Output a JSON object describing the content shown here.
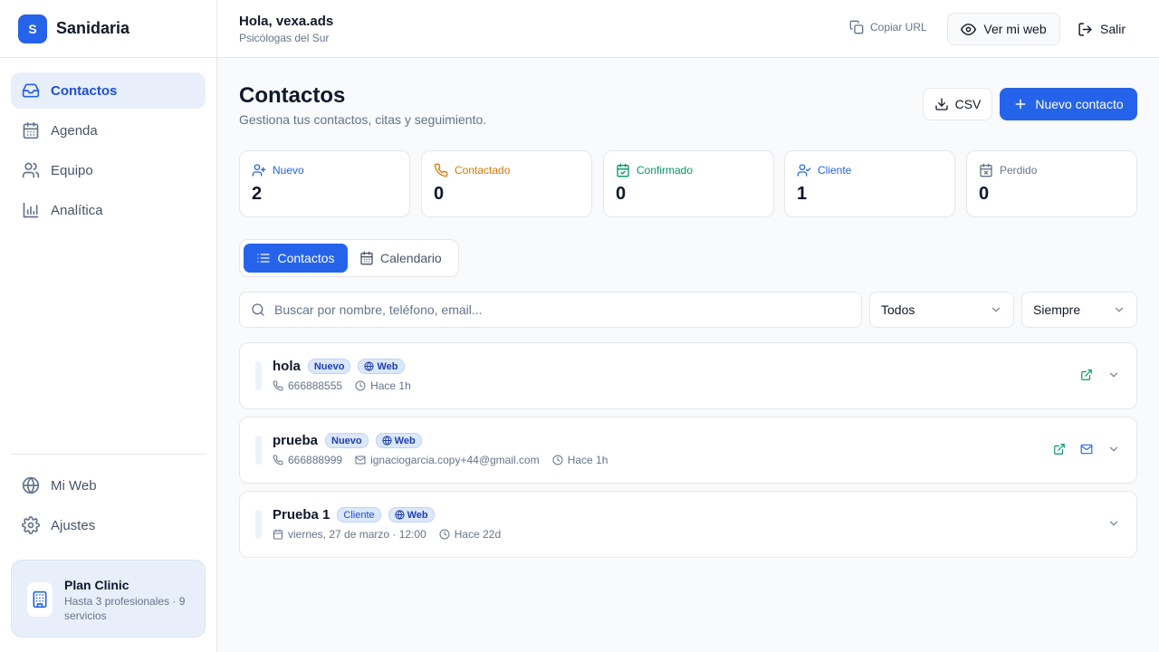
{
  "brand": {
    "initial": "S",
    "name": "Sanidaria"
  },
  "sidebar": {
    "nav": [
      {
        "label": "Contactos",
        "icon": "inbox-icon",
        "active": true
      },
      {
        "label": "Agenda",
        "icon": "calendar-icon"
      },
      {
        "label": "Equipo",
        "icon": "users-icon"
      },
      {
        "label": "Analítica",
        "icon": "bar-chart-icon"
      }
    ],
    "bottom": [
      {
        "label": "Mi Web",
        "icon": "globe-icon"
      },
      {
        "label": "Ajustes",
        "icon": "gear-icon"
      }
    ],
    "plan": {
      "title": "Plan Clinic",
      "description": "Hasta 3 profesionales · 9 servicios"
    }
  },
  "header": {
    "greeting": "Hola, vexa.ads",
    "org": "Psicólogas del Sur",
    "copy_url": "Copiar URL",
    "view_site": "Ver mi web",
    "logout": "Salir"
  },
  "main": {
    "title": "Contactos",
    "subtitle": "Gestiona tus contactos, citas y seguimiento.",
    "csv_label": "CSV",
    "new_contact_label": "Nuevo contacto",
    "stats": [
      {
        "label": "Nuevo",
        "value": "2",
        "color": "#2563eb",
        "icon": "user-plus-icon"
      },
      {
        "label": "Contactado",
        "value": "0",
        "color": "#d97706",
        "icon": "phone-icon"
      },
      {
        "label": "Confirmado",
        "value": "0",
        "color": "#059669",
        "icon": "calendar-check-icon"
      },
      {
        "label": "Cliente",
        "value": "1",
        "color": "#2563eb",
        "icon": "user-check-icon"
      },
      {
        "label": "Perdido",
        "value": "0",
        "color": "#64748b",
        "icon": "calendar-x-icon"
      }
    ],
    "tabs": [
      {
        "label": "Contactos",
        "active": true
      },
      {
        "label": "Calendario"
      }
    ],
    "search_placeholder": "Buscar por nombre, teléfono, email...",
    "filter_status": "Todos",
    "filter_time": "Siempre",
    "contacts": [
      {
        "name": "hola",
        "status": "Nuevo",
        "source": "Web",
        "phone": "666888555",
        "time": "Hace 1h"
      },
      {
        "name": "prueba",
        "status": "Nuevo",
        "source": "Web",
        "phone": "666888999",
        "email": "ignaciogarcia.copy+44@gmail.com",
        "time": "Hace 1h"
      },
      {
        "name": "Prueba 1",
        "status": "Cliente",
        "source": "Web",
        "date": "viernes, 27 de marzo · 12:00",
        "time": "Hace 22d"
      }
    ]
  }
}
